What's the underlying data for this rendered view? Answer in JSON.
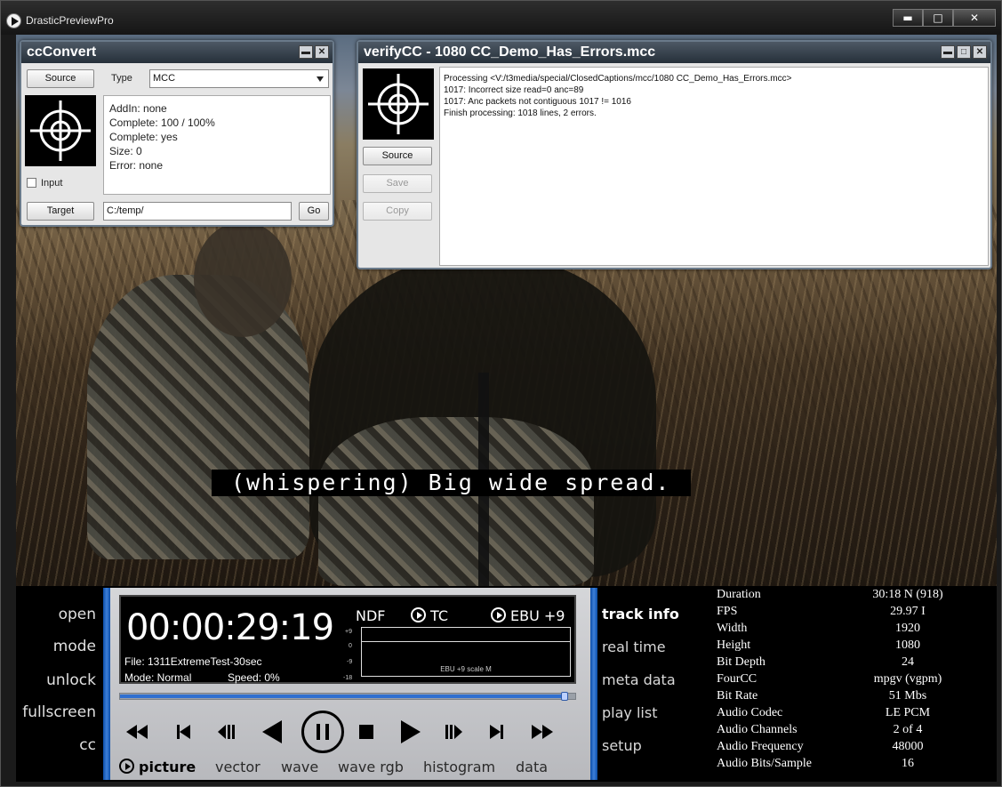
{
  "app": {
    "title": "DrasticPreviewPro"
  },
  "window_buttons": {
    "minimize": "▬",
    "maximize": "□",
    "close": "✕"
  },
  "caption_text": "(whispering) Big wide spread.",
  "ccConvert": {
    "title": "ccConvert",
    "source_label": "Source",
    "type_label": "Type",
    "type_value": "MCC",
    "info": [
      "AddIn: none",
      "Complete: 100 / 100%",
      "Complete: yes",
      "Size: 0",
      "Error: none"
    ],
    "input_label": "Input",
    "target_label": "Target",
    "target_path": "C:/temp/",
    "go_label": "Go"
  },
  "verifyCC": {
    "title": "verifyCC - 1080 CC_Demo_Has_Errors.mcc",
    "source_label": "Source",
    "save_label": "Save",
    "copy_label": "Copy",
    "log": [
      "Processing <V:/t3media/special/ClosedCaptions/mcc/1080 CC_Demo_Has_Errors.mcc>",
      "1017: Incorrect size read=0 anc=89",
      "1017: Anc packets not contiguous 1017 != 1016",
      "Finish processing: 1018 lines, 2 errors."
    ]
  },
  "left_nav": [
    "open",
    "mode",
    "unlock",
    "fullscreen",
    "cc"
  ],
  "timecode": {
    "value": "00:00:29:19",
    "file": "File: 1311ExtremeTest-30sec",
    "mode": "Mode: Normal",
    "speed": "Speed: 0%",
    "ndf": "NDF",
    "tc": "TC",
    "ebu": "EBU +9",
    "meter_ticks": [
      "+9",
      "0",
      "-9",
      "-18"
    ],
    "meter_label": "EBU +9 scale M"
  },
  "seek": {
    "progress": 0.985
  },
  "view_tabs": [
    "picture",
    "vector",
    "wave",
    "wave rgb",
    "histogram",
    "data"
  ],
  "right_nav": [
    "track info",
    "real time",
    "meta data",
    "play list",
    "setup"
  ],
  "track_info": [
    {
      "key": "Duration",
      "value": "30:18 N (918)"
    },
    {
      "key": "FPS",
      "value": "29.97 I"
    },
    {
      "key": "Width",
      "value": "1920"
    },
    {
      "key": "Height",
      "value": "1080"
    },
    {
      "key": "Bit Depth",
      "value": "24"
    },
    {
      "key": "FourCC",
      "value": "mpgv (vgpm)"
    },
    {
      "key": "Bit Rate",
      "value": "51 Mbs"
    },
    {
      "key": "Audio Codec",
      "value": "LE PCM"
    },
    {
      "key": "Audio Channels",
      "value": "2 of 4"
    },
    {
      "key": "Audio Frequency",
      "value": "48000"
    },
    {
      "key": "Audio Bits/Sample",
      "value": "16"
    }
  ]
}
